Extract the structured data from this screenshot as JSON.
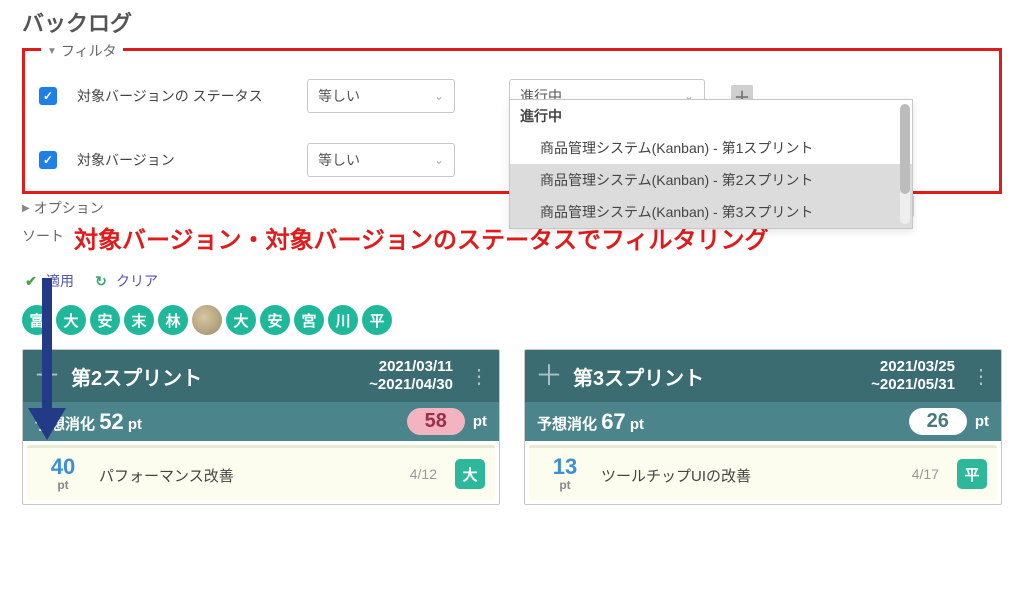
{
  "page": {
    "title": "バックログ"
  },
  "filter": {
    "legend": "フィルタ",
    "rows": [
      {
        "checked": true,
        "label": "対象バージョンの ステータス",
        "operator": "等しい",
        "value": "進行中"
      },
      {
        "checked": true,
        "label": "対象バージョン",
        "operator": "等しい",
        "value": ""
      }
    ],
    "dropdown": {
      "group_label": "進行中",
      "options": [
        {
          "label": "商品管理システム(Kanban) - 第1スプリント",
          "selected": false
        },
        {
          "label": "商品管理システム(Kanban) - 第2スプリント",
          "selected": true
        },
        {
          "label": "商品管理システム(Kanban) - 第3スプリント",
          "selected": true
        }
      ]
    }
  },
  "options_label": "オプション",
  "sort_label_prefix": "ソート",
  "annotation": "対象バージョン・対象バージョンのステータスでフィルタリング",
  "actions": {
    "apply": "適用",
    "clear": "クリア"
  },
  "avatars": [
    "富",
    "大",
    "安",
    "末",
    "林",
    "",
    "大",
    "安",
    "宮",
    "川",
    "平"
  ],
  "sprints": [
    {
      "title": "第2スプリント",
      "date_from": "2021/03/11",
      "date_to": "~2021/04/30",
      "est_label": "予想消化",
      "est_pts": "52",
      "est_unit": "pt",
      "badge_value": "58",
      "badge_style": "pink",
      "badge_unit": "pt",
      "cards": [
        {
          "pts": "40",
          "unit": "pt",
          "title": "パフォーマンス改善",
          "date": "4/12",
          "assignee": "大"
        }
      ]
    },
    {
      "title": "第3スプリント",
      "date_from": "2021/03/25",
      "date_to": "~2021/05/31",
      "est_label": "予想消化",
      "est_pts": "67",
      "est_unit": "pt",
      "badge_value": "26",
      "badge_style": "white",
      "badge_unit": "pt",
      "cards": [
        {
          "pts": "13",
          "unit": "pt",
          "title": "ツールチップUIの改善",
          "date": "4/17",
          "assignee": "平"
        }
      ]
    }
  ]
}
